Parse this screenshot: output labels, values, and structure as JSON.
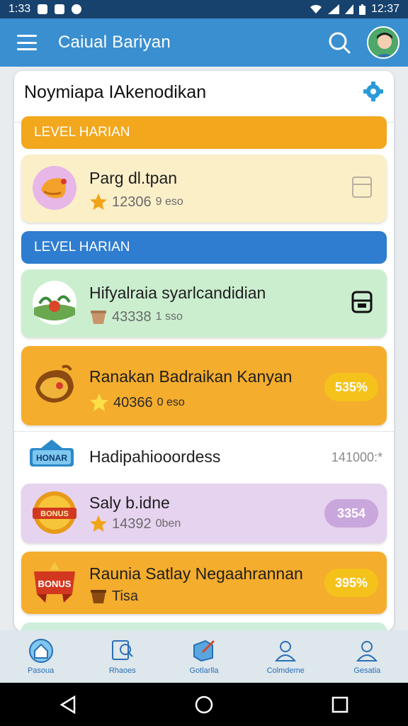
{
  "status_bar": {
    "time": "1:33",
    "clock": "12:37"
  },
  "app_bar": {
    "title": "Caiual Bariyan"
  },
  "card": {
    "title": "Noymiapa IAkenodikan",
    "section_daily_1": "LEVEL HARIAN",
    "section_daily_2": "LEVEL HARIAN"
  },
  "items": [
    {
      "title": "Parg dl.tpan",
      "value": "12306",
      "unit": "9 eso",
      "status": "locked"
    },
    {
      "title": "Hifyalraia syarlcandidian",
      "value": "43338",
      "unit": "1 sso",
      "status": "locked"
    },
    {
      "title": "Ranakan Badraikan Kanyan",
      "value": "40366",
      "unit": "0 eso",
      "badge": "535%"
    }
  ],
  "section_row": {
    "badge": "HONAR",
    "title": "Hadipahiooordess",
    "value": "141000:*"
  },
  "items2": [
    {
      "title": "Saly b.idne",
      "value": "14392",
      "unit": "0ben",
      "badge": "3354"
    },
    {
      "title": "Raunia Satlay Negaahrannan",
      "sub": "Tisa",
      "badge": "395%"
    }
  ],
  "bottom_nav": [
    {
      "label": "Pasoua",
      "icon": "home-icon"
    },
    {
      "label": "Rhaoes",
      "icon": "search-doc-icon"
    },
    {
      "label": "Gotlarlla",
      "icon": "edit-box-icon"
    },
    {
      "label": "Colmdeme",
      "icon": "person-icon"
    },
    {
      "label": "Gesatia",
      "icon": "profile-icon"
    }
  ],
  "colors": {
    "app_bar": "#3a8fd1",
    "orange": "#f2a71d",
    "blue": "#2f7dd0",
    "pill_yellow": "#f5c21b",
    "pill_purple": "#c9a6dc"
  }
}
